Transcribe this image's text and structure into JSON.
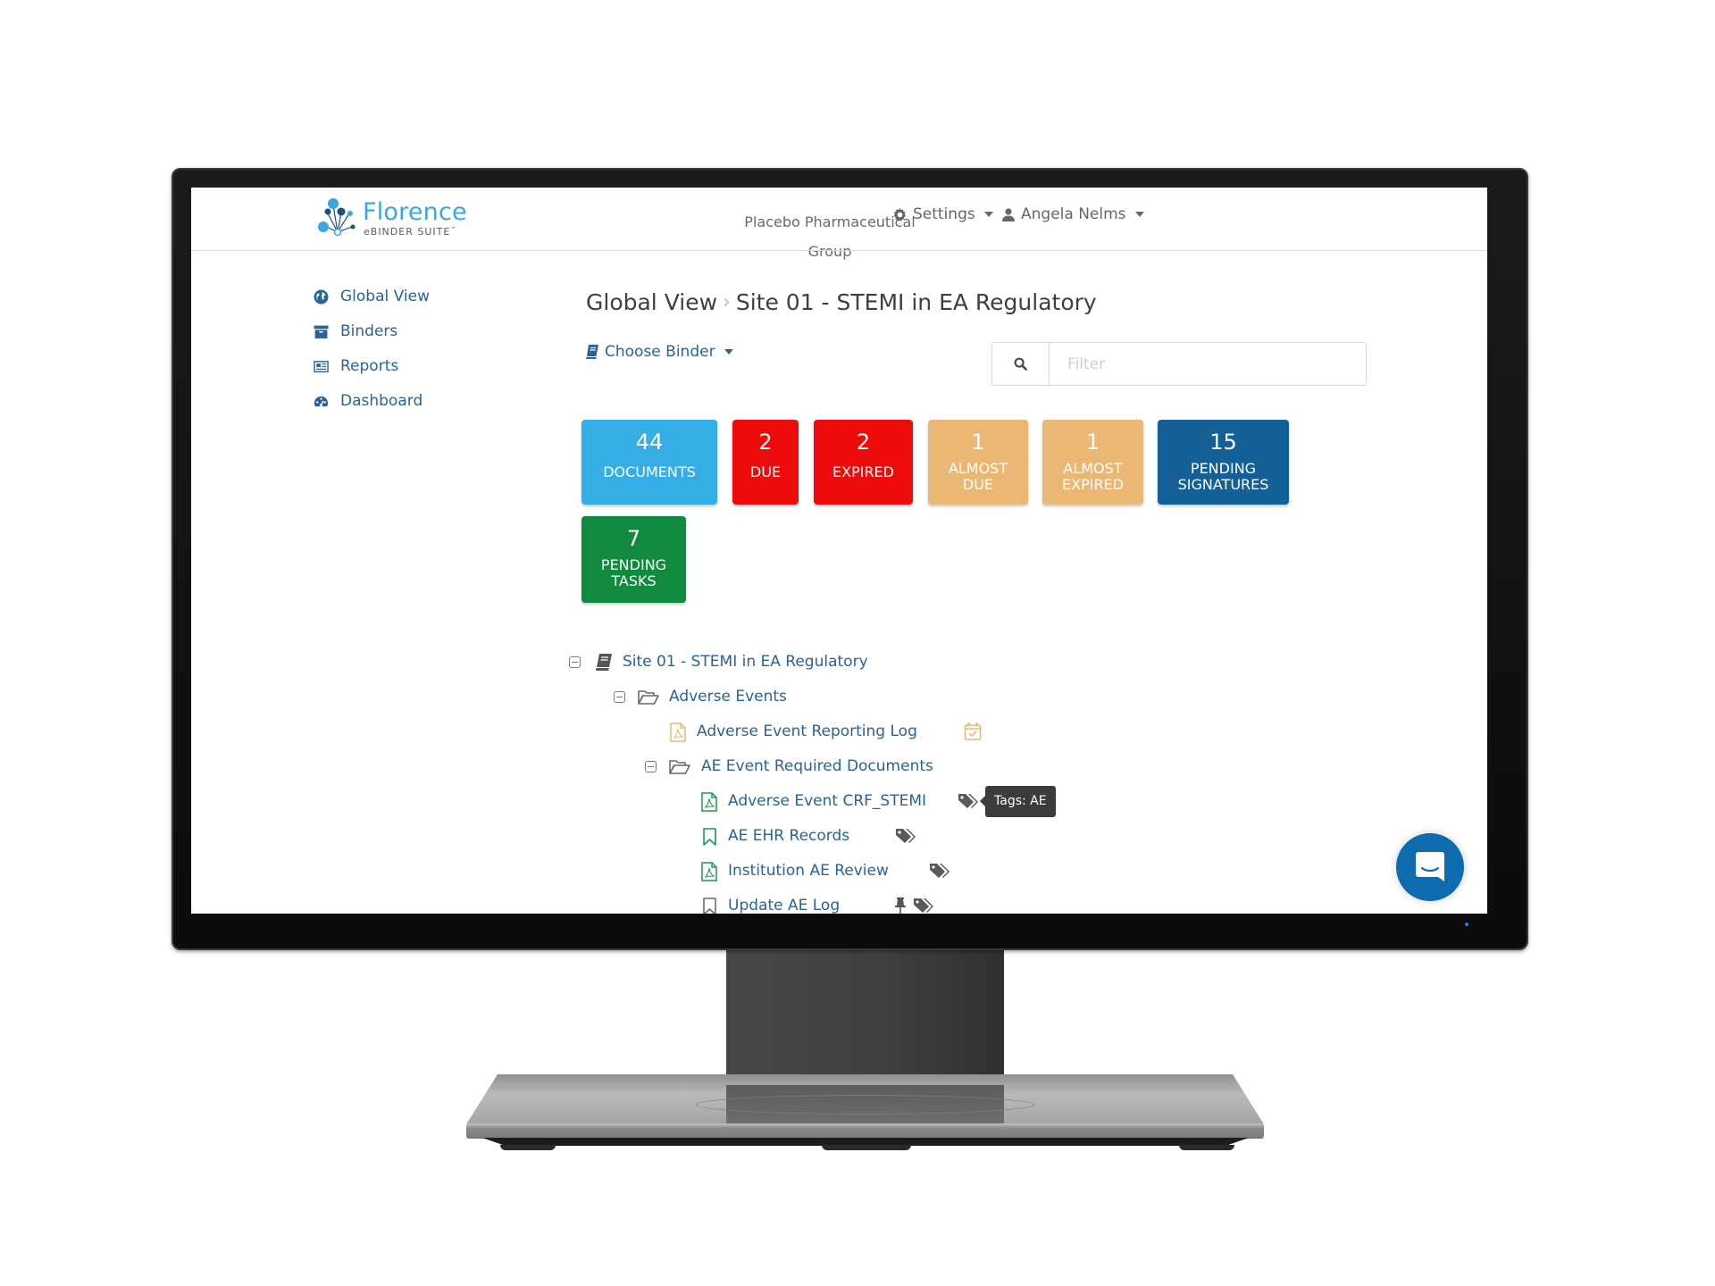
{
  "app": {
    "logo_title": "Florence",
    "logo_subtitle": "eBINDER SUITE",
    "logo_trademark": "™",
    "brand_color": "#3aa8df",
    "link_color": "#2b6394"
  },
  "header": {
    "organization_line1": "Placebo Pharmaceutical",
    "organization_line2": "Group",
    "settings_label": "Settings",
    "user_label": "Angela Nelms"
  },
  "sidebar": {
    "items": [
      {
        "label": "Global View",
        "icon": "globe-icon"
      },
      {
        "label": "Binders",
        "icon": "archive-icon"
      },
      {
        "label": "Reports",
        "icon": "newspaper-icon"
      },
      {
        "label": "Dashboard",
        "icon": "dashboard-icon"
      }
    ]
  },
  "breadcrumb": {
    "root": "Global View",
    "separator": "›",
    "current": "Site 01 - STEMI in EA Regulatory"
  },
  "toolbar": {
    "choose_binder_label": "Choose Binder",
    "filter_placeholder": "Filter",
    "filter_value": ""
  },
  "tiles": [
    {
      "count": "44",
      "label": "DOCUMENTS",
      "color": "#35aee6"
    },
    {
      "count": "2",
      "label": "DUE",
      "color": "#ee0b0b"
    },
    {
      "count": "2",
      "label": "EXPIRED",
      "color": "#ee0b0b"
    },
    {
      "count": "1",
      "label_line1": "ALMOST",
      "label_line2": "DUE",
      "color": "#ebb774"
    },
    {
      "count": "1",
      "label_line1": "ALMOST",
      "label_line2": "EXPIRED",
      "color": "#ebb774"
    },
    {
      "count": "15",
      "label_line1": "PENDING",
      "label_line2": "SIGNATURES",
      "color": "#145f95"
    },
    {
      "count": "7",
      "label_line1": "PENDING",
      "label_line2": "TASKS",
      "color": "#0f8a3e"
    }
  ],
  "tree": {
    "binder": {
      "name": "Site 01 - STEMI in EA Regulatory",
      "expanded": true
    },
    "folder": {
      "name": "Adverse Events",
      "expanded": true
    },
    "items": [
      {
        "name": "Adverse Event Reporting Log",
        "type": "pdf",
        "status": "due-soon",
        "badge": "calendar-check-icon"
      },
      {
        "name": "AE Event Required Documents",
        "type": "folder",
        "expanded": true
      },
      {
        "name": "Adverse Event CRF_STEMI",
        "type": "pdf",
        "status": "complete",
        "badge": "tags-icon"
      },
      {
        "name": "AE EHR Records",
        "type": "placeholder",
        "status": "complete",
        "badge": "tags-icon"
      },
      {
        "name": "Institution AE Review",
        "type": "pdf",
        "status": "complete",
        "badge": "tags-icon"
      },
      {
        "name": "Update AE Log",
        "type": "placeholder",
        "status": "empty",
        "badge": "tags-icon",
        "pinned": true
      }
    ]
  },
  "tooltip": {
    "text": "Tags: AE"
  },
  "chat": {
    "icon": "chat-icon"
  }
}
